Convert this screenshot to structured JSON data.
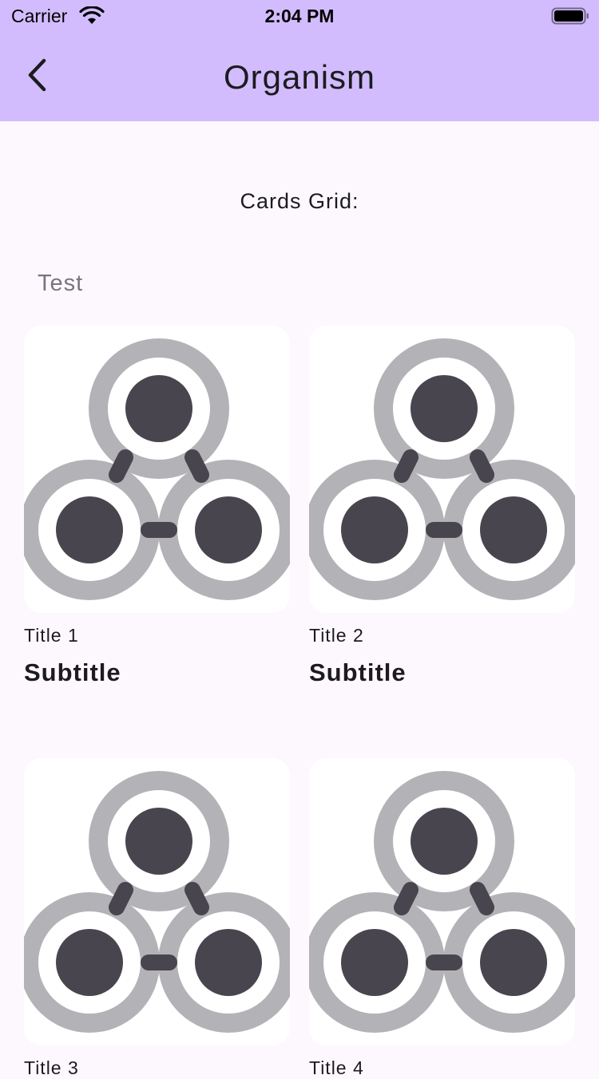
{
  "status_bar": {
    "carrier": "Carrier",
    "time": "2:04 PM",
    "icons": [
      "wifi-icon",
      "battery-icon"
    ]
  },
  "app_bar": {
    "title": "Organism",
    "back_icon": "chevron-left-icon",
    "background_color": "#d2bcfd"
  },
  "content": {
    "heading": "Cards Grid:",
    "group_label": "Test",
    "cards": [
      {
        "title": "Title 1",
        "subtitle": "Subtitle",
        "image_icon": "connected-nodes-icon"
      },
      {
        "title": "Title 2",
        "subtitle": "Subtitle",
        "image_icon": "connected-nodes-icon"
      },
      {
        "title": "Title 3",
        "subtitle": "",
        "image_icon": "connected-nodes-icon"
      },
      {
        "title": "Title 4",
        "subtitle": "",
        "image_icon": "connected-nodes-icon"
      }
    ]
  },
  "colors": {
    "background": "#fdf8fd",
    "icon_ring": "#b3b2b7",
    "icon_dot": "#49454f",
    "muted_text": "#79747e"
  }
}
